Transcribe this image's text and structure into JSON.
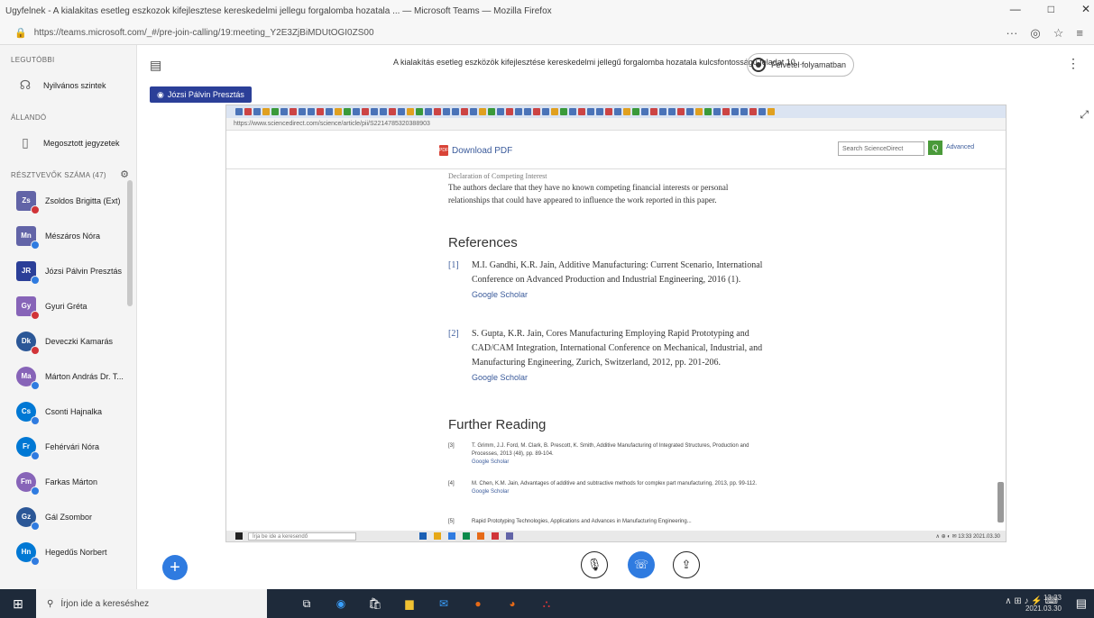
{
  "browser": {
    "window_title": "Ugyfelnek - A kialakitas esetleg eszkozok kifejlesztese kereskedelmi jellegu forgalomba hozatala ... — Microsoft Teams — Mozilla Firefox",
    "url": "https://teams.microsoft.com/_#/pre-join-calling/19:meeting_Y2E3ZjBiMDUtOGI0ZS00",
    "min": "—",
    "max": "□",
    "close": "✕",
    "more_label": "···",
    "shield": "◎",
    "star": "☆",
    "menu": "≡"
  },
  "sidebar": {
    "sections": [
      {
        "label": "LEGUTÓBBI"
      },
      {
        "label": "ÁLLANDÓ"
      },
      {
        "label": "RÉSZTVEVŐK SZÁMA (47)"
      }
    ],
    "top_items": [
      {
        "label": "Nyilvános szintek"
      },
      {
        "label": "Megosztott jegyzetek"
      }
    ],
    "participants": [
      {
        "initials": "Zs",
        "name": "Zsoldos Brigitta (Ext)",
        "color": "#6264a7",
        "status": "#d13438",
        "square": true
      },
      {
        "initials": "Mn",
        "name": "Mészáros Nóra",
        "color": "#6264a7",
        "status": "#2f7be0",
        "square": true
      },
      {
        "initials": "JR",
        "name": "Józsi Pálvin Presztás",
        "color": "#2b3f98",
        "status": "#2f7be0",
        "square": true
      },
      {
        "initials": "Gy",
        "name": "Gyuri Gréta",
        "color": "#8764b8",
        "status": "#d13438",
        "square": true
      },
      {
        "initials": "Dk",
        "name": "Deveczki Kamarás",
        "color": "#2b5797",
        "status": "#d13438",
        "square": false
      },
      {
        "initials": "Ma",
        "name": "Márton András Dr. T...",
        "color": "#8764b8",
        "status": "#2f7be0",
        "square": false
      },
      {
        "initials": "Cs",
        "name": "Csonti Hajnalka",
        "color": "#0078d4",
        "status": "#2f7be0",
        "square": false
      },
      {
        "initials": "Fr",
        "name": "Fehérvári Nóra",
        "color": "#0078d4",
        "status": "#2f7be0",
        "square": false
      },
      {
        "initials": "Fm",
        "name": "Farkas Márton",
        "color": "#8764b8",
        "status": "#2f7be0",
        "square": false
      },
      {
        "initials": "Gz",
        "name": "Gál Zsombor",
        "color": "#2b5797",
        "status": "#2f7be0",
        "square": false
      },
      {
        "initials": "Hn",
        "name": "Hegedűs Norbert",
        "color": "#0078d4",
        "status": "#2f7be0",
        "square": false
      }
    ]
  },
  "meeting": {
    "title": "A kialakítás esetleg eszközök kifejlesztése kereskedelmi jellegű forgalomba hozatala kulcsfontosságú feladat 10...",
    "status_label": "Felvétel folyamatban",
    "presenter": "Józsi Pálvin Presztás",
    "chat_icon": "▤",
    "more_icon": "⋮",
    "expand_icon": "⤢",
    "add_icon": "+",
    "mic_icon": "🎙",
    "phone_icon": "☏",
    "share_icon": "⇪"
  },
  "shared_screen": {
    "address": "https://www.sciencedirect.com/science/article/pii/S2214785320388903",
    "download_pdf": "Download PDF",
    "search_placeholder": "Search ScienceDirect",
    "search_btn": "Q",
    "advanced": "Advanced",
    "statement_cut": "Declaration of Competing Interest",
    "statement": "The authors declare that they have no known competing financial interests or personal relationships that could have appeared to influence the work reported in this paper.",
    "references_title": "References",
    "references": [
      {
        "num": "[1]",
        "text": "M.I. Gandhi, K.R. Jain, Additive Manufacturing: Current Scenario, International Conference on Advanced Production and Industrial Engineering, 2016 (1).",
        "scholar": "Google Scholar"
      },
      {
        "num": "[2]",
        "text": "S. Gupta, K.R. Jain, Cores Manufacturing Employing Rapid Prototyping and CAD/CAM Integration, International Conference on Mechanical, Industrial, and Manufacturing Engineering, Zurich, Switzerland, 2012, pp. 201-206.",
        "scholar": "Google Scholar"
      }
    ],
    "further_title": "Further Reading",
    "further": [
      {
        "num": "[3]",
        "text": "T. Grimm, J.J. Ford, M. Clark, B. Prescott, K. Smith, Additive Manufacturing of Integrated Structures, Production and Processes, 2013 (48), pp. 89-104.",
        "scholar": "Google Scholar"
      },
      {
        "num": "[4]",
        "text": "M. Chen, K.M. Jain, Advantages of additive and subtractive methods for complex part manufacturing, 2013, pp. 99-112.",
        "scholar": "Google Scholar"
      },
      {
        "num": "[5]",
        "text": "Rapid Prototyping Technologies, Applications and Advances in Manufacturing Engineering...",
        "scholar": ""
      }
    ],
    "taskbar_search": "Írja be ide a keresendő",
    "tray": "∧  ⊕  ◐  ✉   13:33  2021.03.30"
  },
  "taskbar": {
    "start_icon": "⊞",
    "search_icon": "⚲",
    "search_placeholder": "Írjon ide a kereséshez",
    "tray_icons": "∧   ⊞   ♪   ⚡   ⌨",
    "time": "13:33",
    "date": "2021.03.30",
    "notif_icon": "▤"
  }
}
